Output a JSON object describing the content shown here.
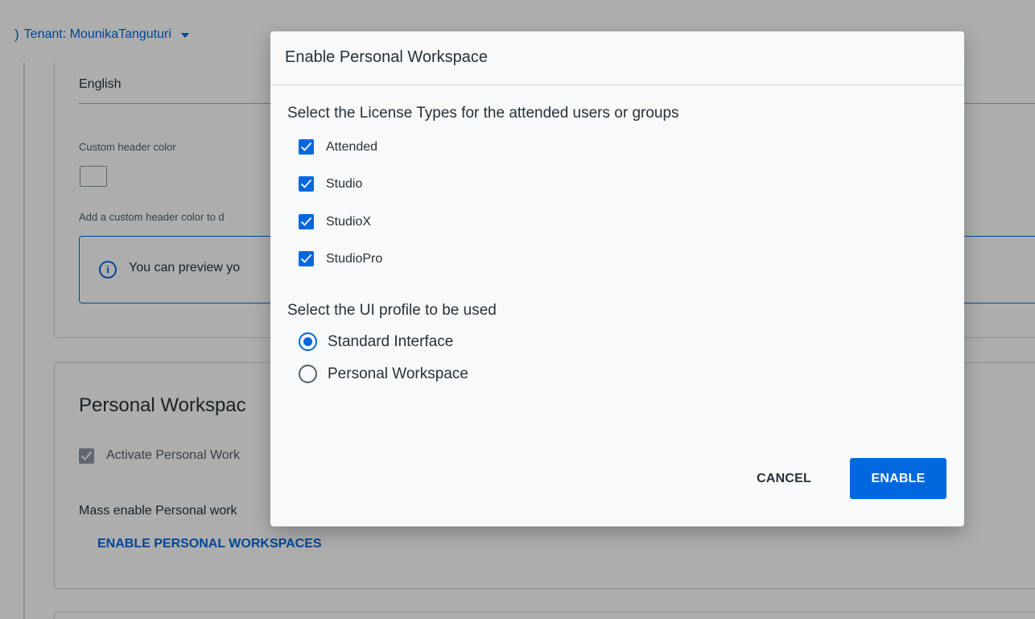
{
  "header": {
    "tenant_paren": ")",
    "tenant_label": "Tenant: MounikaTanguturi"
  },
  "background": {
    "language_value": "English",
    "custom_header_color_label": "Custom header color",
    "custom_header_color_help": "Add a custom header color to d",
    "info_text": "You can preview yo",
    "personal_workspace_title": "Personal Workspac",
    "activate_label": "Activate Personal Work",
    "mass_enable_label": "Mass enable Personal work",
    "enable_workspaces_link": "ENABLE PERSONAL WORKSPACES"
  },
  "dialog": {
    "title": "Enable Personal Workspace",
    "license_label": "Select the License Types for the attended users or groups",
    "license_types": [
      {
        "label": "Attended",
        "checked": true
      },
      {
        "label": "Studio",
        "checked": true
      },
      {
        "label": "StudioX",
        "checked": true
      },
      {
        "label": "StudioPro",
        "checked": true
      }
    ],
    "ui_profile_label": "Select the UI profile to be used",
    "ui_profiles": [
      {
        "label": "Standard Interface",
        "selected": true
      },
      {
        "label": "Personal Workspace",
        "selected": false
      }
    ],
    "cancel_label": "CANCEL",
    "enable_label": "ENABLE"
  },
  "colors": {
    "accent": "#0067df",
    "overlay": "rgba(0,0,0,0.32)",
    "dialog_bg": "#f8f9fa"
  }
}
